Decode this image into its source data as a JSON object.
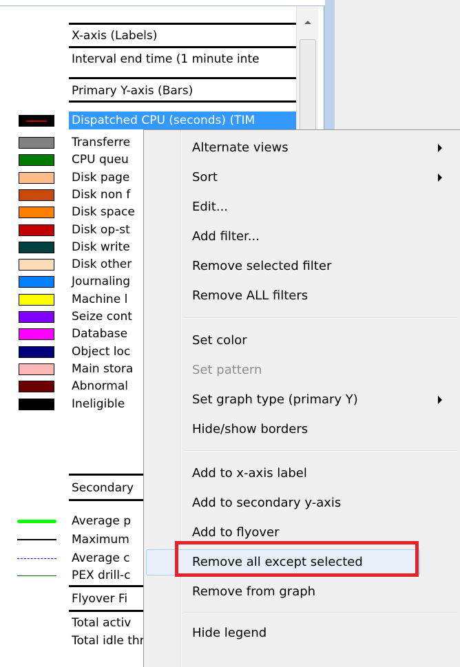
{
  "legend": {
    "x_axis_header": "X-axis (Labels)",
    "x_axis_item": "Interval end time (1 minute inte",
    "primary_y_header": "Primary Y-axis (Bars)",
    "selected_item": "Dispatched CPU (seconds) (TIM",
    "items": [
      {
        "label": "Transferre",
        "color": "#808080"
      },
      {
        "label": "CPU queu",
        "color": "#007a00"
      },
      {
        "label": "Disk page",
        "color": "#ffbb88"
      },
      {
        "label": "Disk non f",
        "color": "#c84a0a"
      },
      {
        "label": "Disk space",
        "color": "#ff8000"
      },
      {
        "label": "Disk op-st",
        "color": "#c00000"
      },
      {
        "label": "Disk write",
        "color": "#00403f"
      },
      {
        "label": "Disk other",
        "color": "#ffdcb8"
      },
      {
        "label": "Journaling",
        "color": "#0080ff"
      },
      {
        "label": "Machine l",
        "color": "#ffff00"
      },
      {
        "label": "Seize cont",
        "color": "#8000ff"
      },
      {
        "label": "Database",
        "color": "#ff00ff"
      },
      {
        "label": "Object loc",
        "color": "#00007a"
      },
      {
        "label": "Main stora",
        "color": "#ffb8b8"
      },
      {
        "label": "Abnormal",
        "color": "#6b0000"
      },
      {
        "label": "Ineligible",
        "color": "#000000"
      }
    ],
    "secondary_y_header": "Secondary",
    "lines": [
      {
        "label": "Average p",
        "color": "#00ff00",
        "style": "solid-thick"
      },
      {
        "label": "Maximum",
        "color": "#000000",
        "style": "solid"
      },
      {
        "label": "Average c",
        "color": "#0000ff",
        "style": "dashed"
      },
      {
        "label": "PEX drill-c",
        "color": "#006400",
        "style": "solid-thin"
      }
    ],
    "flyover_header": "Flyover Fi",
    "flyover_items": [
      "Total activ",
      "Total idle threads/tasks (TOTID"
    ]
  },
  "context_menu": {
    "items": [
      {
        "label": "Alternate views",
        "submenu": true
      },
      {
        "label": "Sort",
        "submenu": true
      },
      {
        "label": "Edit..."
      },
      {
        "label": "Add filter..."
      },
      {
        "label": "Remove selected filter"
      },
      {
        "label": "Remove ALL filters"
      },
      {
        "label": "Set color"
      },
      {
        "label": "Set pattern",
        "disabled": true
      },
      {
        "label": "Set graph type (primary Y)",
        "submenu": true
      },
      {
        "label": "Hide/show borders"
      },
      {
        "label": "Add to x-axis label"
      },
      {
        "label": "Add to secondary y-axis"
      },
      {
        "label": "Add to flyover"
      },
      {
        "label": "Remove all except selected",
        "highlighted": true
      },
      {
        "label": "Remove from graph"
      },
      {
        "label": "Hide legend"
      }
    ]
  }
}
